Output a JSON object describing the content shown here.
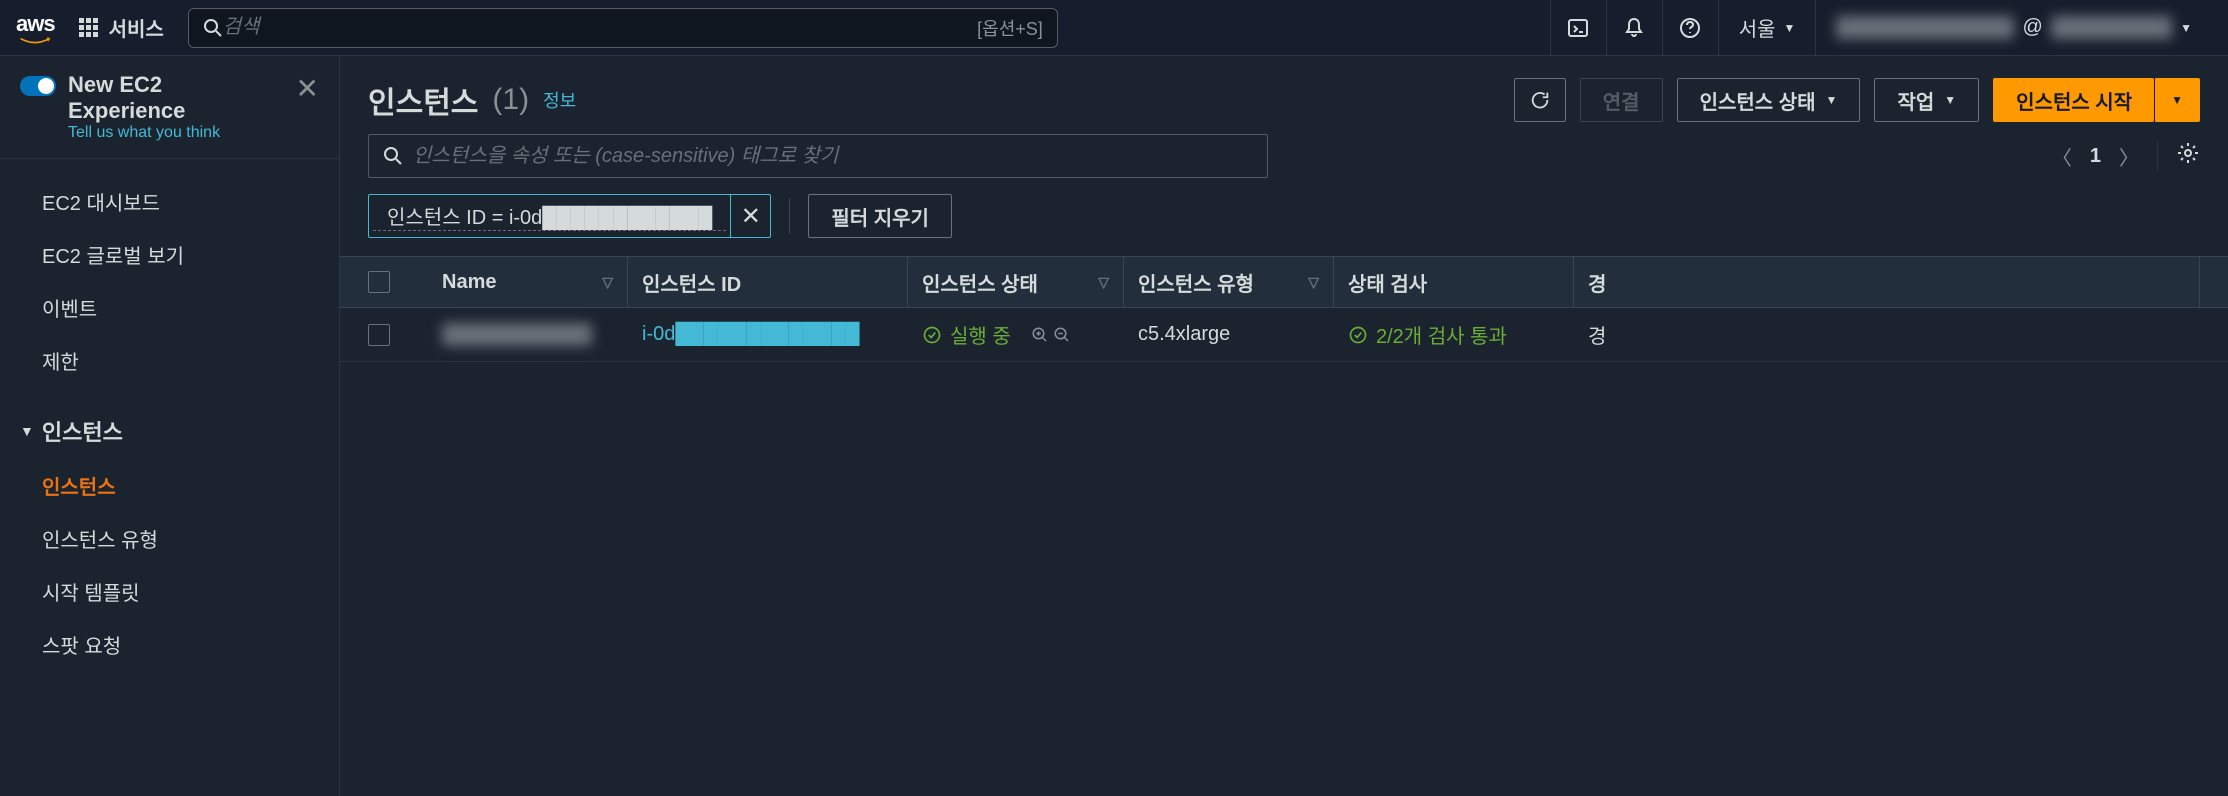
{
  "topnav": {
    "services": "서비스",
    "search_placeholder": "검색",
    "search_shortcut": "[옵션+S]",
    "region": "서울",
    "account_left": "████████████",
    "account_at": "@",
    "account_right": "████████"
  },
  "sidebar": {
    "new_exp_title": "New EC2 Experience",
    "new_exp_link": "Tell us what you think",
    "items_top": [
      "EC2 대시보드",
      "EC2 글로벌 보기",
      "이벤트",
      "제한"
    ],
    "group_instances": "인스턴스",
    "items_instances": [
      "인스턴스",
      "인스턴스 유형",
      "시작 템플릿",
      "스팟 요청"
    ]
  },
  "page": {
    "title": "인스턴스",
    "count": "(1)",
    "info": "정보",
    "connect": "연결",
    "state_menu": "인스턴스 상태",
    "action_menu": "작업",
    "launch": "인스턴스 시작",
    "filter_placeholder": "인스턴스을 속성 또는 (case-sensitive) 태그로 찾기",
    "page_num": "1",
    "chip": "인스턴스 ID = i-0d████████████",
    "clear_filter": "필터 지우기"
  },
  "table": {
    "headers": {
      "name": "Name",
      "id": "인스턴스 ID",
      "state": "인스턴스 상태",
      "type": "인스턴스 유형",
      "status": "상태 검사",
      "alarm": "경"
    },
    "row": {
      "name": "██████████",
      "id": "i-0d█████████████",
      "state": "실행 중",
      "type": "c5.4xlarge",
      "status": "2/2개 검사 통과",
      "alarm": "경"
    }
  }
}
